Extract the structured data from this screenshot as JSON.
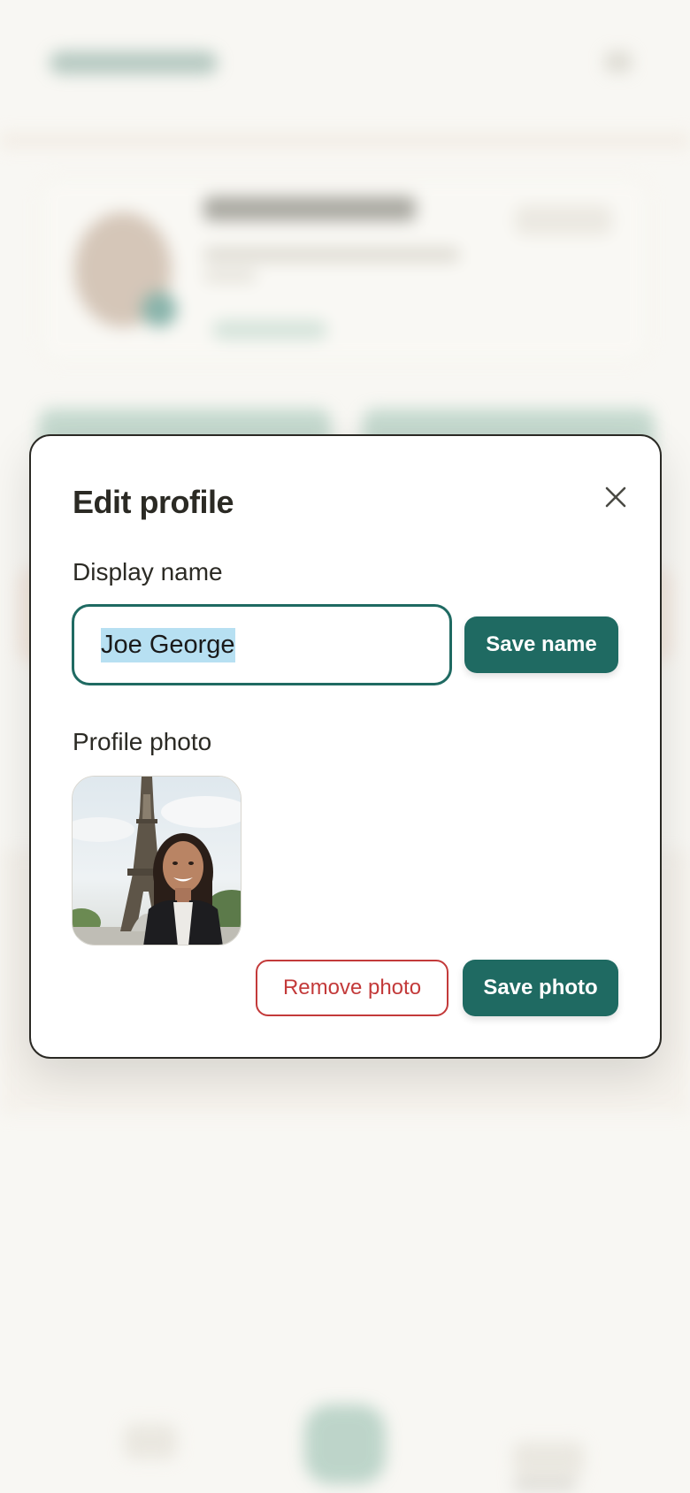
{
  "modal": {
    "title": "Edit profile",
    "display_name_label": "Display name",
    "display_name_value": "Joe George",
    "save_name_label": "Save name",
    "profile_photo_label": "Profile photo",
    "remove_photo_label": "Remove photo",
    "save_photo_label": "Save photo",
    "close_icon": "close-icon"
  },
  "colors": {
    "primary": "#1f6a62",
    "danger": "#c33a3a",
    "selection": "#b7e0f2",
    "page_bg": "#f8f7f3"
  }
}
